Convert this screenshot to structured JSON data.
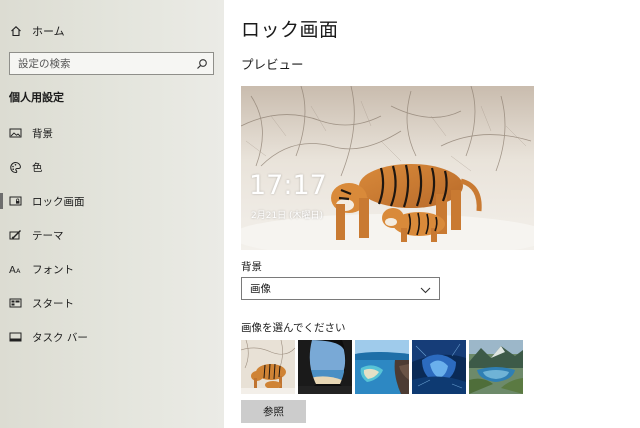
{
  "sidebar": {
    "home_label": "ホーム",
    "search_placeholder": "設定の検索",
    "section_title": "個人用設定",
    "items": [
      {
        "label": "背景",
        "icon": "image-icon"
      },
      {
        "label": "色",
        "icon": "palette-icon"
      },
      {
        "label": "ロック画面",
        "icon": "lock-screen-icon",
        "selected": true
      },
      {
        "label": "テーマ",
        "icon": "theme-brush-icon"
      },
      {
        "label": "フォント",
        "icon": "font-icon"
      },
      {
        "label": "スタート",
        "icon": "start-icon"
      },
      {
        "label": "タスク バー",
        "icon": "taskbar-icon"
      }
    ]
  },
  "main": {
    "title": "ロック画面",
    "preview_title": "プレビュー",
    "preview": {
      "time": "17:17",
      "date": "2月21日 (木曜日)"
    },
    "background_label": "背景",
    "background_value": "画像",
    "choose_image_label": "画像を選んでください",
    "thumbnails": [
      "tigers",
      "cave-beach",
      "turquoise-bay",
      "ice-cave",
      "mountain-lake"
    ],
    "browse_button": "参照"
  },
  "colors": {
    "sidebar_bg": "#e4e5dd",
    "selected_indicator": "#6d6d6d",
    "button_bg": "#cccccc"
  }
}
